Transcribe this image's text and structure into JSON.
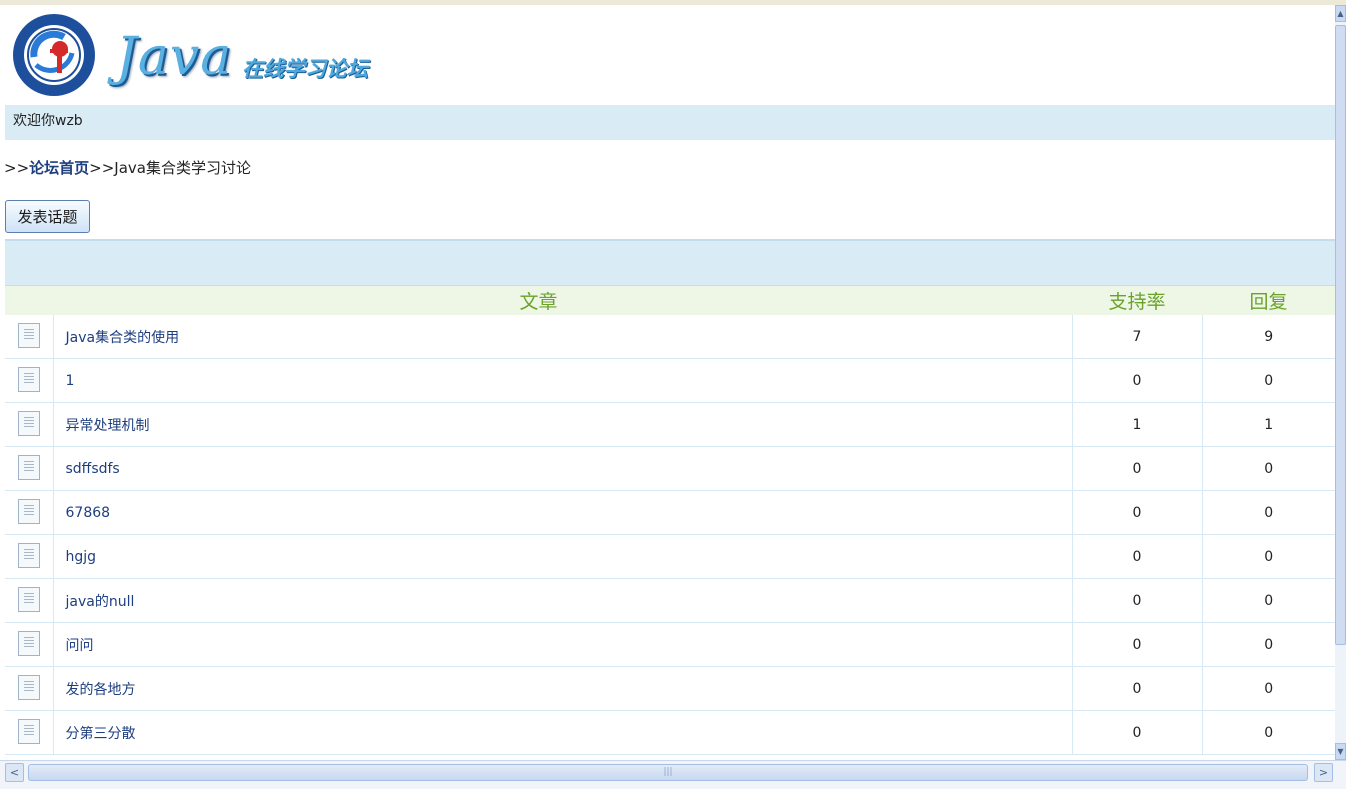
{
  "logo": {
    "title": "Java",
    "subtitle": "在线学习论坛"
  },
  "welcome": "欢迎你wzb",
  "breadcrumb": {
    "prefix": ">>",
    "home": "论坛首页",
    "sep": ">>",
    "current": "Java集合类学习讨论"
  },
  "post_button": "发表话题",
  "table": {
    "headers": {
      "article": "文章",
      "support": "支持率",
      "reply": "回复"
    },
    "rows": [
      {
        "title": "Java集合类的使用",
        "support": "7",
        "reply": "9"
      },
      {
        "title": "1",
        "support": "0",
        "reply": "0"
      },
      {
        "title": "异常处理机制",
        "support": "1",
        "reply": "1"
      },
      {
        "title": "sdffsdfs",
        "support": "0",
        "reply": "0"
      },
      {
        "title": "67868",
        "support": "0",
        "reply": "0"
      },
      {
        "title": "hgjg",
        "support": "0",
        "reply": "0"
      },
      {
        "title": "java的null",
        "support": "0",
        "reply": "0"
      },
      {
        "title": "问问",
        "support": "0",
        "reply": "0"
      },
      {
        "title": "发的各地方",
        "support": "0",
        "reply": "0"
      },
      {
        "title": "分第三分散",
        "support": "0",
        "reply": "0"
      }
    ]
  },
  "icons": {
    "row": "document-icon",
    "scroll_left": "arrow-left-icon",
    "scroll_right": "arrow-right-icon",
    "scroll_up": "arrow-up-icon",
    "scroll_down": "arrow-down-icon"
  },
  "colors": {
    "link": "#1e3f7f",
    "band": "#d9ecf6",
    "header_text": "#6aa22c",
    "header_bg": "#eef6e6"
  }
}
